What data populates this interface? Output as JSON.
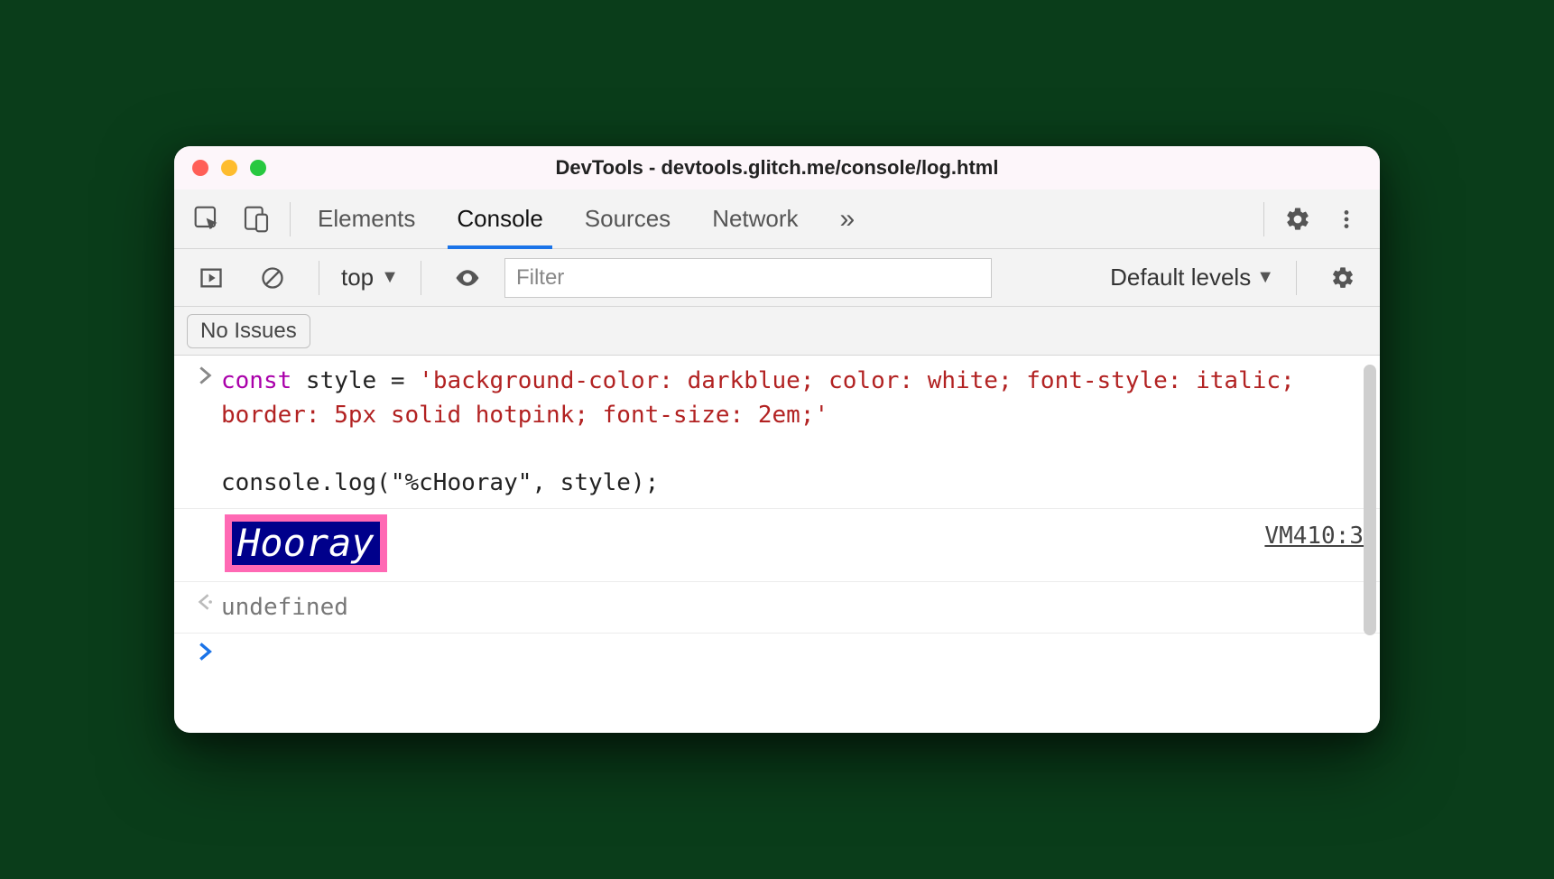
{
  "window": {
    "title": "DevTools - devtools.glitch.me/console/log.html"
  },
  "tabs": {
    "elements": "Elements",
    "console": "Console",
    "sources": "Sources",
    "network": "Network"
  },
  "console_toolbar": {
    "context": "top",
    "filter_placeholder": "Filter",
    "levels": "Default levels"
  },
  "issues": {
    "label": "No Issues"
  },
  "entries": {
    "input": {
      "kw": "const",
      "decl": " style = ",
      "str": "'background-color: darkblue; color: white; font-style: italic; border: 5px solid hotpink; font-size: 2em;'",
      "blank_and_call": "\n\nconsole.log(\"%cHooray\", style);"
    },
    "styled": {
      "text": "Hooray",
      "source": "VM410:3"
    },
    "return": "undefined"
  }
}
